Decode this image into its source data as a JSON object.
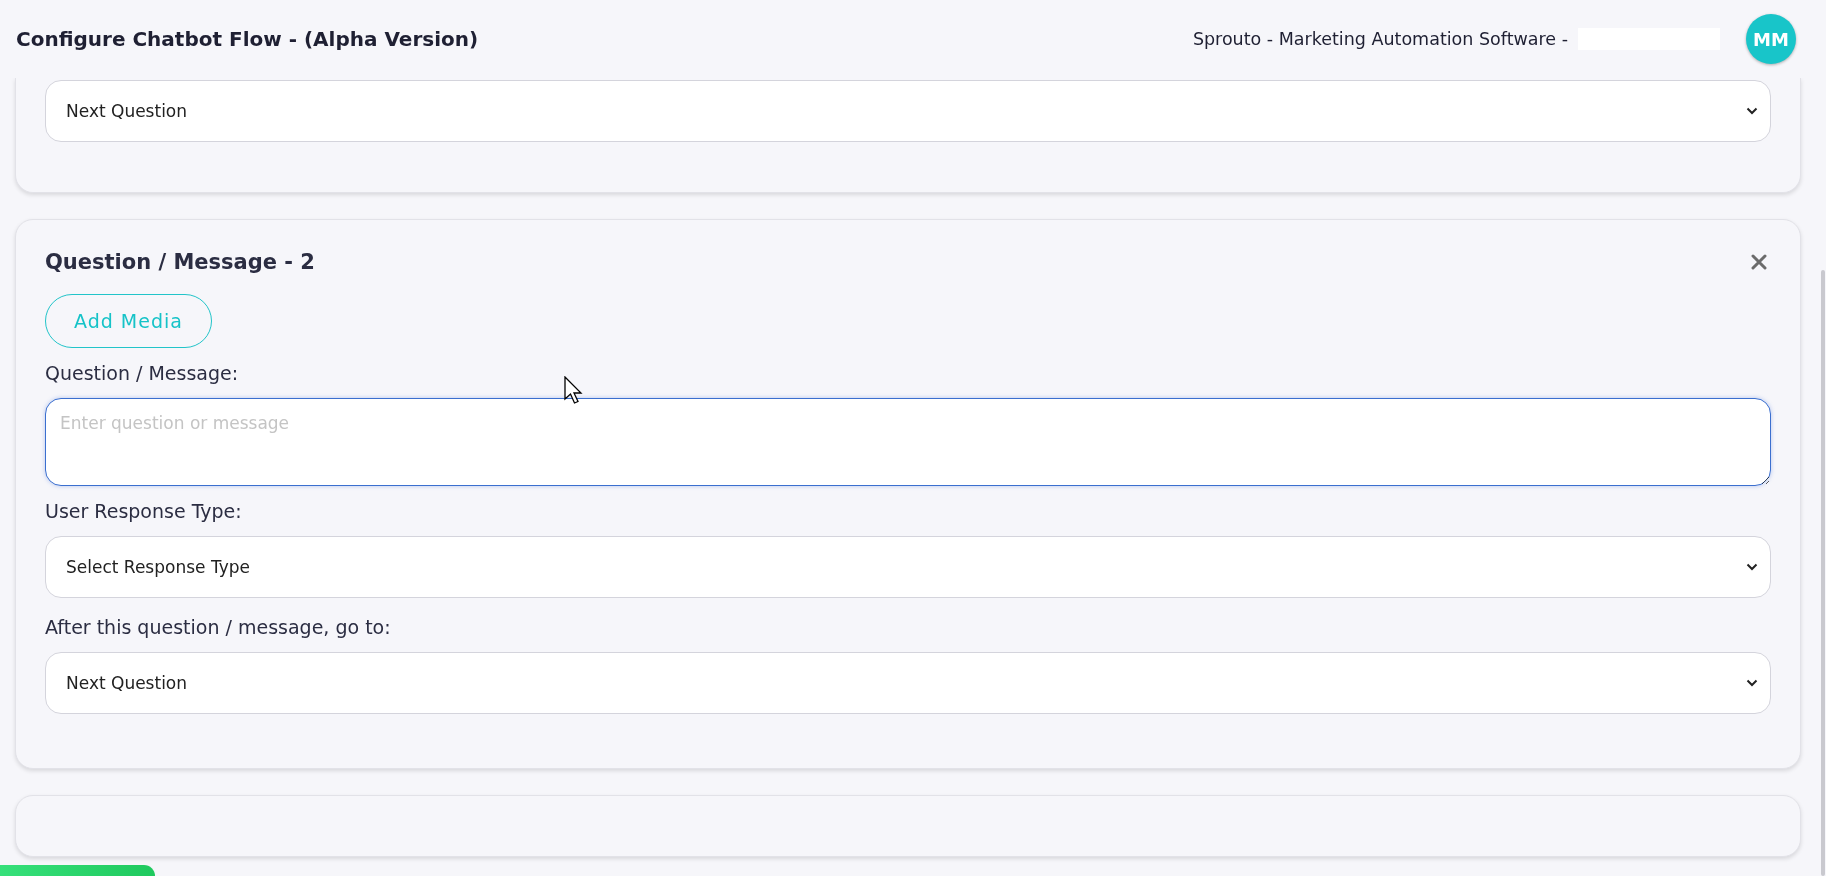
{
  "header": {
    "title": "Configure Chatbot Flow - (Alpha Version)",
    "app_name": "Sprouto - Marketing Automation Software -",
    "avatar": "MM"
  },
  "cards": [
    {
      "kind": "partial",
      "fields": [
        {
          "kind": "select",
          "value": "Next Question"
        }
      ]
    },
    {
      "kind": "question",
      "title": "Question / Message - 2",
      "add_media": "Add Media",
      "fields": [
        {
          "kind": "textarea",
          "label": "Question / Message:",
          "placeholder": "Enter question or message",
          "focused": true
        },
        {
          "kind": "select",
          "label": "User Response Type:",
          "value": "Select Response Type"
        },
        {
          "kind": "select",
          "label": "After this question / message, go to:",
          "value": "Next Question"
        }
      ]
    },
    {
      "kind": "stub"
    }
  ]
}
